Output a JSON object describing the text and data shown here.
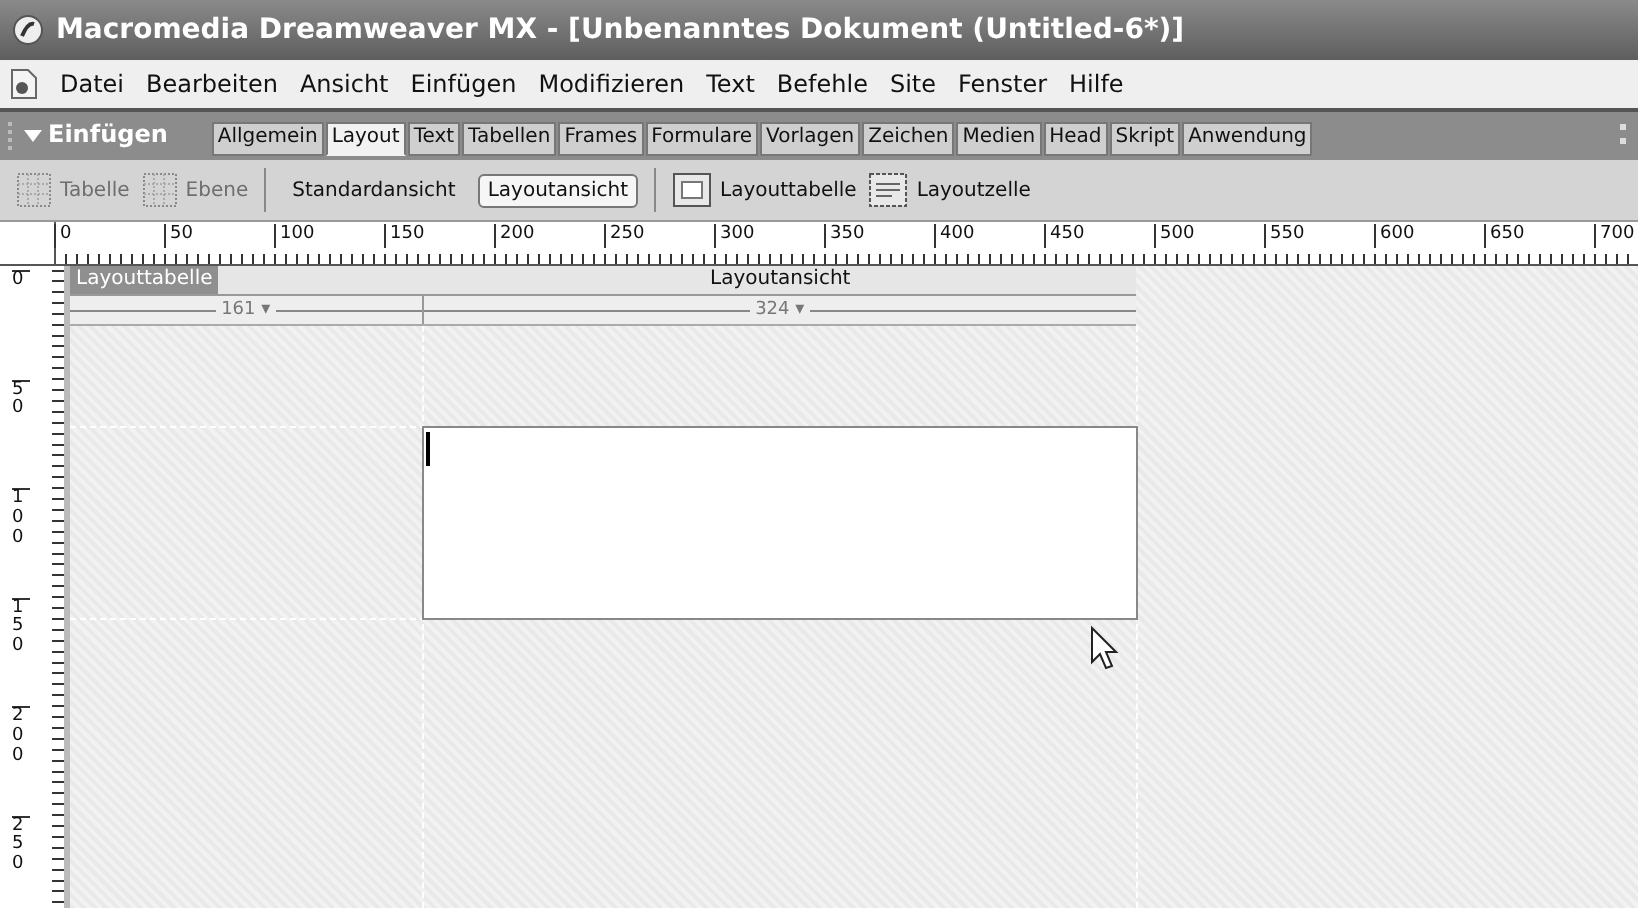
{
  "window": {
    "title": "Macromedia Dreamweaver MX - [Unbenanntes Dokument (Untitled-6*)]"
  },
  "menu": [
    "Datei",
    "Bearbeiten",
    "Ansicht",
    "Einfügen",
    "Modifizieren",
    "Text",
    "Befehle",
    "Site",
    "Fenster",
    "Hilfe"
  ],
  "insert_bar": {
    "title": "Einfügen",
    "expanded": true,
    "tabs": [
      {
        "label": "Allgemein",
        "selected": false
      },
      {
        "label": "Layout",
        "selected": true
      },
      {
        "label": "Text",
        "selected": false
      },
      {
        "label": "Tabellen",
        "selected": false
      },
      {
        "label": "Frames",
        "selected": false
      },
      {
        "label": "Formulare",
        "selected": false
      },
      {
        "label": "Vorlagen",
        "selected": false
      },
      {
        "label": "Zeichen",
        "selected": false
      },
      {
        "label": "Medien",
        "selected": false
      },
      {
        "label": "Head",
        "selected": false
      },
      {
        "label": "Skript",
        "selected": false
      },
      {
        "label": "Anwendung",
        "selected": false
      }
    ]
  },
  "toolbar": {
    "draw_tools": [
      {
        "label": "Tabelle",
        "disabled": true
      },
      {
        "label": "Ebene",
        "disabled": true
      }
    ],
    "views": [
      {
        "label": "Standardansicht",
        "selected": false
      },
      {
        "label": "Layoutansicht",
        "selected": true
      }
    ],
    "layout_tools": [
      {
        "label": "Layouttabelle",
        "disabled": false
      },
      {
        "label": "Layoutzelle",
        "disabled": false
      }
    ]
  },
  "ruler": {
    "horizontal": [
      "0",
      "50",
      "100",
      "150",
      "200",
      "250",
      "300",
      "350",
      "400",
      "450",
      "500",
      "550",
      "600",
      "650",
      "700"
    ],
    "vertical": [
      "0",
      "50",
      "100",
      "150",
      "200",
      "250"
    ]
  },
  "layout_table": {
    "tab": "Layouttabelle",
    "view_label": "Layoutansicht",
    "column_widths": [
      "161 ▾",
      "324 ▾"
    ]
  }
}
